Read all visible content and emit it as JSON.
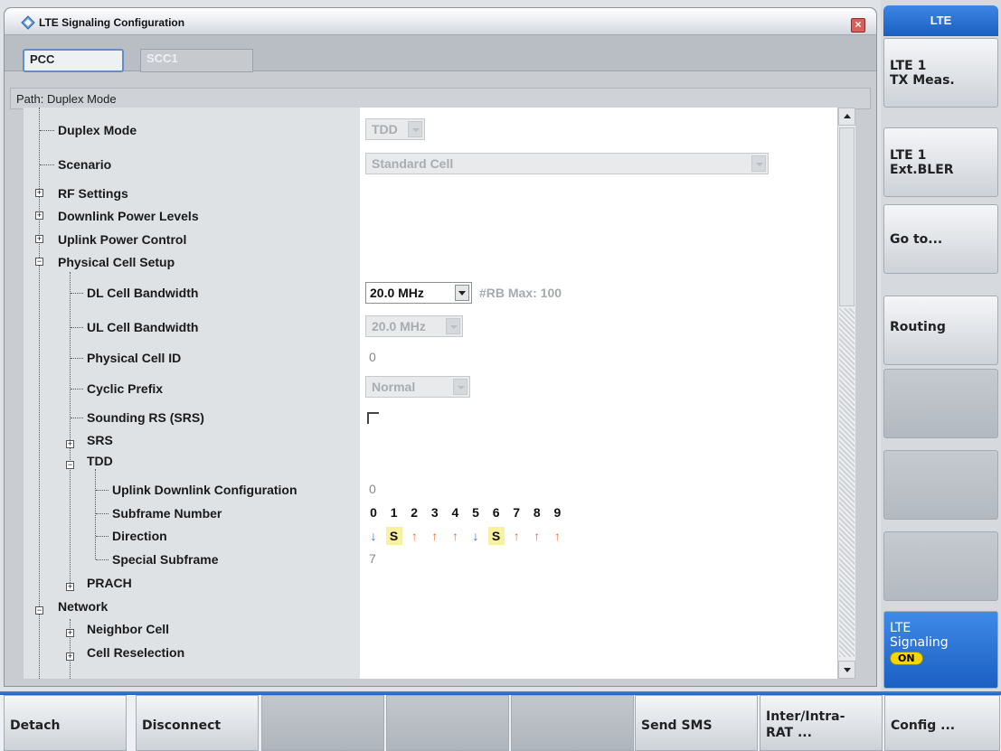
{
  "window": {
    "title": "LTE Signaling Configuration",
    "close_glyph": "×"
  },
  "tabs": [
    {
      "label": "PCC",
      "active": true
    },
    {
      "label": "SCC1",
      "active": false
    }
  ],
  "path": {
    "label": "Path:",
    "value": "Duplex Mode"
  },
  "tree": {
    "duplex_mode": {
      "label": "Duplex Mode",
      "value": "TDD"
    },
    "scenario": {
      "label": "Scenario",
      "value": "Standard Cell"
    },
    "rf_settings": {
      "label": "RF Settings"
    },
    "downlink_power_levels": {
      "label": "Downlink Power Levels"
    },
    "uplink_power_control": {
      "label": "Uplink Power Control"
    },
    "physical_cell_setup": {
      "label": "Physical Cell Setup"
    },
    "dl_cell_bandwidth": {
      "label": "DL Cell Bandwidth",
      "value": "20.0 MHz",
      "extra": "#RB Max:  100"
    },
    "ul_cell_bandwidth": {
      "label": "UL Cell Bandwidth",
      "value": "20.0 MHz"
    },
    "physical_cell_id": {
      "label": "Physical Cell ID",
      "value": "0"
    },
    "cyclic_prefix": {
      "label": "Cyclic Prefix",
      "value": "Normal"
    },
    "sounding_rs": {
      "label": "Sounding RS (SRS)",
      "checked": false
    },
    "srs": {
      "label": "SRS"
    },
    "tdd": {
      "label": "TDD"
    },
    "uplink_downlink_configuration": {
      "label": "Uplink Downlink Configuration",
      "value": "0"
    },
    "subframe_number": {
      "label": "Subframe Number"
    },
    "direction": {
      "label": "Direction"
    },
    "special_subframe": {
      "label": "Special Subframe",
      "value": "7"
    },
    "prach": {
      "label": "PRACH"
    },
    "network": {
      "label": "Network"
    },
    "neighbor_cell": {
      "label": "Neighbor Cell"
    },
    "cell_reselection": {
      "label": "Cell Reselection"
    }
  },
  "subframes": {
    "numbers": [
      "0",
      "1",
      "2",
      "3",
      "4",
      "5",
      "6",
      "7",
      "8",
      "9"
    ],
    "directions": [
      {
        "glyph": "↓",
        "kind": "down"
      },
      {
        "glyph": "S",
        "kind": "s"
      },
      {
        "glyph": "↑",
        "kind": "up"
      },
      {
        "glyph": "↑",
        "kind": "up"
      },
      {
        "glyph": "↑",
        "kind": "up"
      },
      {
        "glyph": "↓",
        "kind": "down"
      },
      {
        "glyph": "S",
        "kind": "s"
      },
      {
        "glyph": "↑",
        "kind": "up"
      },
      {
        "glyph": "↑",
        "kind": "up"
      },
      {
        "glyph": "↑",
        "kind": "up"
      }
    ]
  },
  "softkeys": {
    "header": "LTE",
    "items": [
      {
        "line1": "LTE 1",
        "line2": "TX Meas."
      },
      {
        "line1": "LTE 1",
        "line2": "Ext.BLER"
      },
      {
        "line1": "Go to...",
        "line2": ""
      },
      {
        "line1": "Routing",
        "line2": ""
      },
      {
        "line1": "",
        "line2": ""
      },
      {
        "line1": "",
        "line2": ""
      },
      {
        "line1": "",
        "line2": ""
      }
    ],
    "signaling": {
      "line1": "LTE",
      "line2": "Signaling",
      "badge": "ON"
    }
  },
  "bottom": {
    "detach": "Detach",
    "disconnect": "Disconnect",
    "send_sms": "Send SMS",
    "inter_line1": "Inter/Intra-",
    "inter_line2": "RAT ...",
    "config": "Config ..."
  },
  "colors": {
    "accent_blue": "#1a5fc0",
    "downlink_arrow": "#2a6fd0",
    "uplink_arrow": "#ff6a28",
    "special_bg": "#f8f2a0",
    "on_badge": "#f4d600"
  }
}
